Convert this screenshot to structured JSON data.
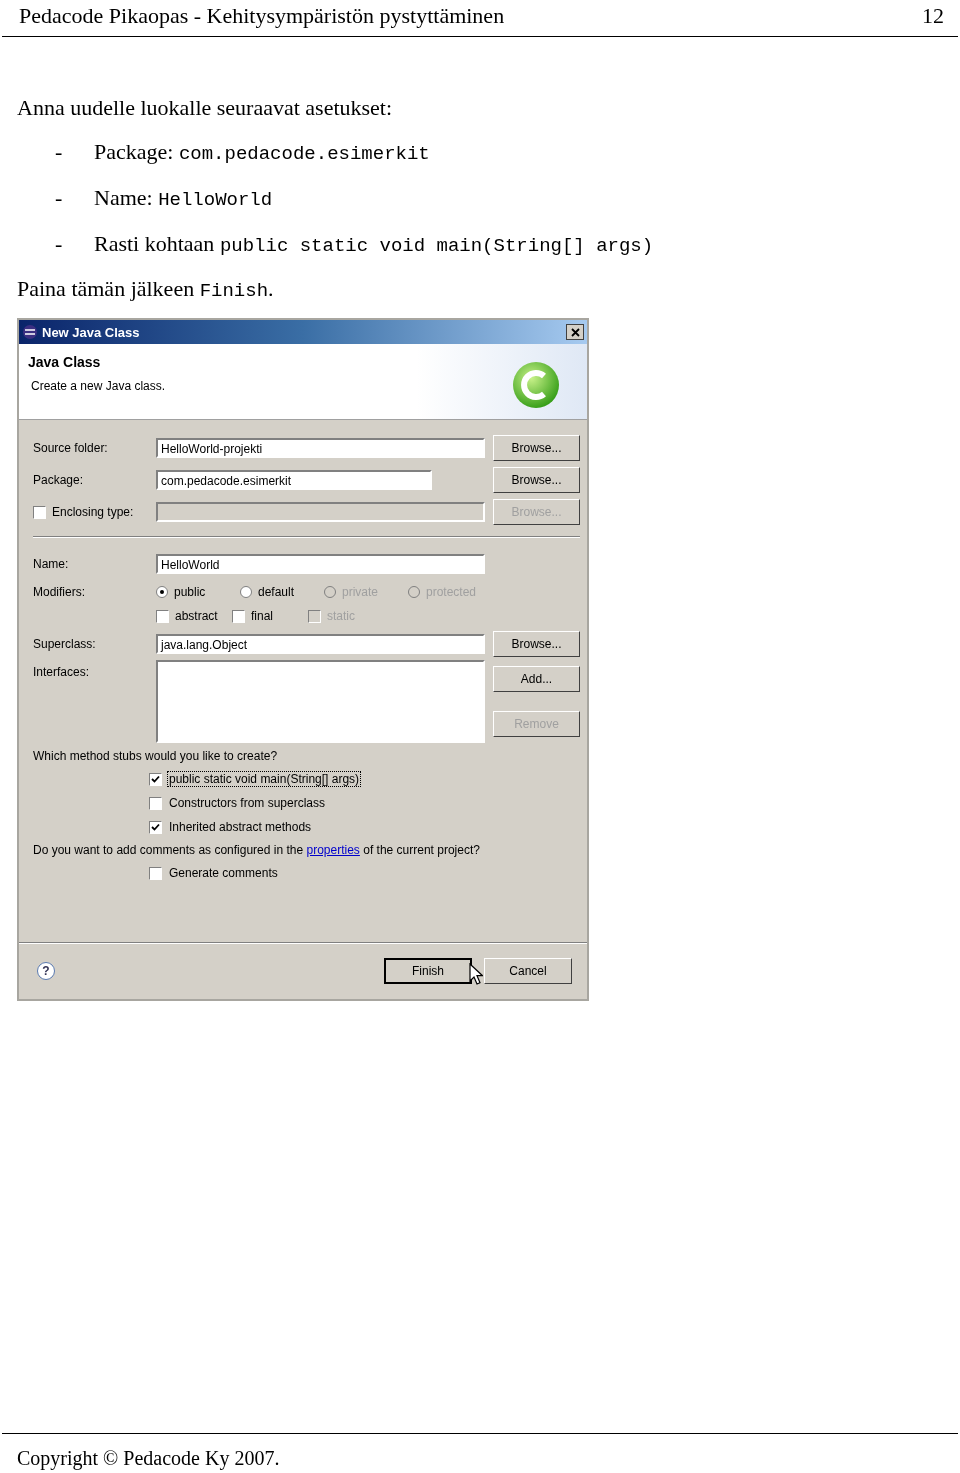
{
  "page_header": {
    "title": "Pedacode Pikaopas - Kehitysympäristön pystyttäminen",
    "page_number": "12"
  },
  "intro": "Anna uudelle luokalle seuraavat asetukset:",
  "bullets": [
    {
      "marker": "-",
      "text": "Package:",
      "code": "com.pedacode.esimerkit"
    },
    {
      "marker": "-",
      "text": "Name:",
      "code": "HelloWorld"
    },
    {
      "marker": "-",
      "text": "Rasti kohtaan",
      "code": "public static void main(String[] args)"
    }
  ],
  "closing": {
    "text": "Paina tämän jälkeen",
    "code": "Finish",
    "end": "."
  },
  "dialog": {
    "title": "New Java Class",
    "header_title": "Java Class",
    "header_subtitle": "Create a new Java class.",
    "rows": [
      {
        "kind": "field",
        "label": "Source folder:",
        "value": "HelloWorld-projekti",
        "button": {
          "label": "Browse...",
          "disabled": false
        }
      },
      {
        "kind": "short_field",
        "label": "Package:",
        "value": "com.pedacode.esimerkit",
        "button": {
          "label": "Browse...",
          "disabled": false
        }
      },
      {
        "kind": "check_field",
        "label": "Enclosing type:",
        "checked": false,
        "button": {
          "label": "Browse...",
          "disabled": true
        }
      },
      {
        "kind": "divider"
      },
      {
        "kind": "field",
        "label": "Name:",
        "value": "HelloWorld"
      },
      {
        "kind": "radios",
        "label": "Modifiers:",
        "options": [
          {
            "label": "public",
            "selected": true,
            "disabled": false
          },
          {
            "label": "default",
            "selected": false,
            "disabled": false
          },
          {
            "label": "private",
            "selected": false,
            "disabled": true
          },
          {
            "label": "protected",
            "selected": false,
            "disabled": true
          }
        ]
      },
      {
        "kind": "checks",
        "options": [
          {
            "label": "abstract",
            "checked": false,
            "disabled": false
          },
          {
            "label": "final",
            "checked": false,
            "disabled": false
          },
          {
            "label": "static",
            "checked": false,
            "disabled": true
          }
        ]
      },
      {
        "kind": "field",
        "label": "Superclass:",
        "value": "java.lang.Object",
        "button": {
          "label": "Browse...",
          "disabled": false
        }
      },
      {
        "kind": "list",
        "label": "Interfaces:",
        "buttons": [
          {
            "label": "Add...",
            "disabled": false
          },
          {
            "label": "Remove",
            "disabled": true
          }
        ]
      }
    ],
    "stubs": {
      "question": "Which method stubs would you like to create?",
      "options": [
        {
          "label": "public static void main(String[] args)",
          "checked": true,
          "focused": true
        },
        {
          "label": "Constructors from superclass",
          "checked": false,
          "focused": false
        },
        {
          "label": "Inherited abstract methods",
          "checked": true,
          "focused": false
        }
      ]
    },
    "comments": {
      "before": "Do you want to add comments as configured in the",
      "link": "properties",
      "after": "of the current project?",
      "options": [
        {
          "label": "Generate comments",
          "checked": false,
          "focused": false
        }
      ]
    },
    "help": "?",
    "buttons": [
      {
        "label": "Finish",
        "default": true
      },
      {
        "label": "Cancel",
        "default": false
      }
    ]
  },
  "footer": "Copyright © Pedacode Ky 2007."
}
